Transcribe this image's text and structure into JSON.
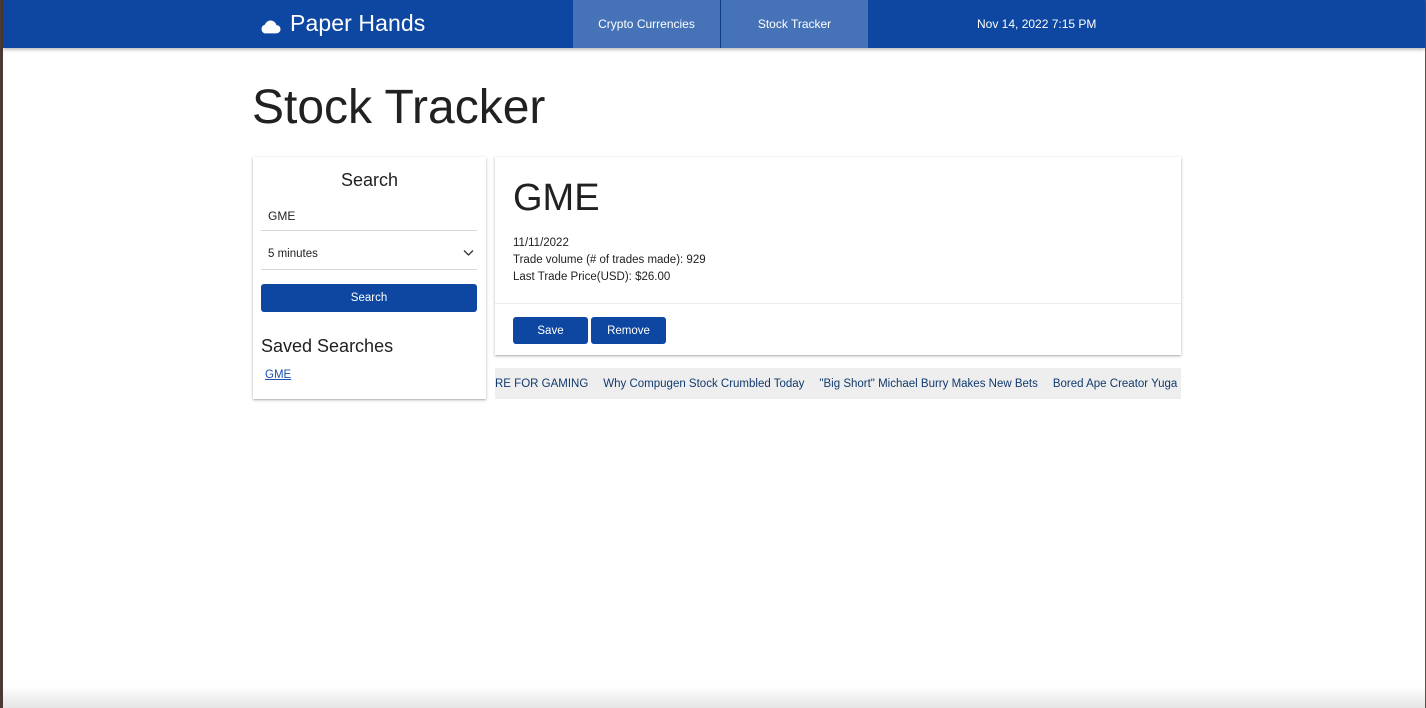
{
  "navbar": {
    "brand": "Paper Hands",
    "brand_icon": "cloud-icon",
    "tabs": [
      {
        "label": "Crypto Currencies"
      },
      {
        "label": "Stock Tracker"
      }
    ],
    "datetime": "Nov 14, 2022 7:15 PM",
    "color": "#0d47a1"
  },
  "page": {
    "title": "Stock Tracker"
  },
  "search": {
    "heading": "Search",
    "ticker_value": "GME",
    "interval_selected": "5 minutes",
    "interval_icon": "chevron-down-icon",
    "button_label": "Search",
    "saved_heading": "Saved Searches",
    "saved_items": [
      "GME"
    ]
  },
  "result": {
    "symbol": "GME",
    "date": "11/11/2022",
    "volume_line": "Trade volume (# of trades made): 929",
    "price_line": "Last Trade Price(USD): $26.00",
    "save_label": "Save",
    "remove_label": "Remove"
  },
  "news": {
    "items": [
      "RE FOR GAMING",
      "Why Compugen Stock Crumbled Today",
      "\"Big Short\" Michael Burry Makes New Bets",
      "Bored Ape Creator Yuga L"
    ]
  }
}
